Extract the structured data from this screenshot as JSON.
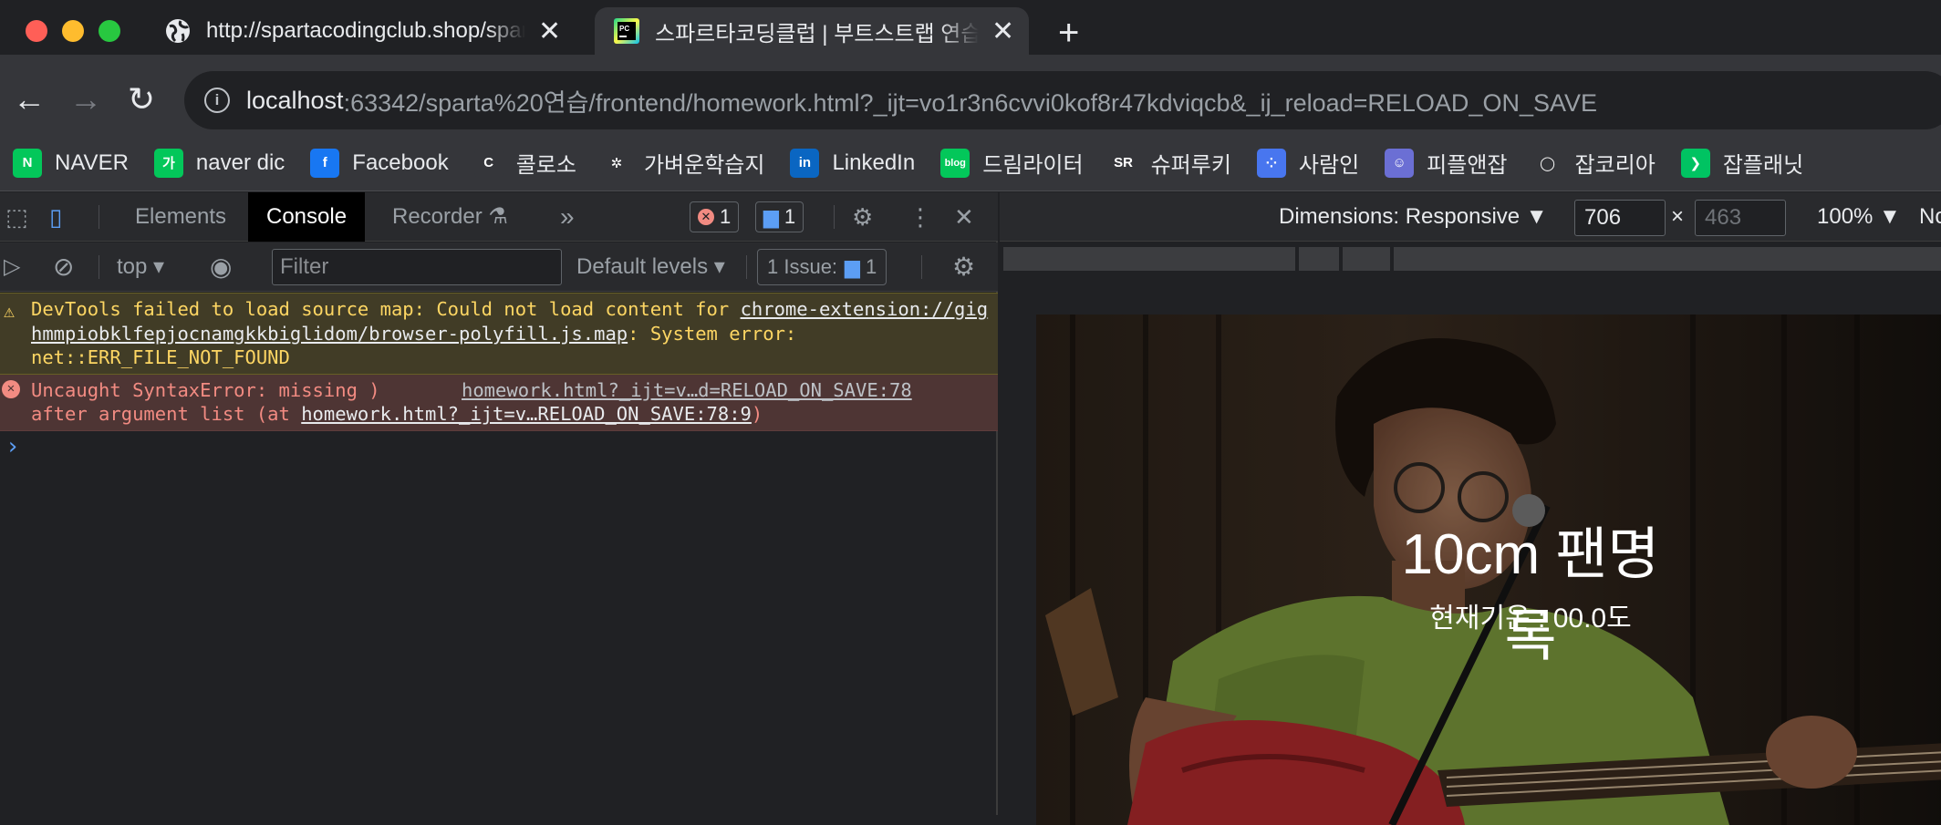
{
  "window": {
    "tabs": [
      {
        "title": "http://spartacodingclub.shop/sparta",
        "icon": "globe-icon",
        "close": "✕"
      },
      {
        "title": "스파르타코딩클럽 | 부트스트랩 연습하기",
        "icon": "pycharm-icon",
        "close": "✕"
      }
    ],
    "new_tab": "+"
  },
  "toolbar": {
    "url_host": "localhost",
    "url_rest": ":63342/sparta%20연습/frontend/homework.html?_ijt=vo1r3n6cvvi0kof8r47kdviqcb&_ij_reload=RELOAD_ON_SAVE",
    "info_icon": "i"
  },
  "bookmarks": [
    {
      "label": "NAVER",
      "icon": "naver-icon",
      "glyph": "N",
      "color": "#03c75a"
    },
    {
      "label": "naver dic",
      "icon": "naver-dictionary-icon",
      "glyph": "가",
      "color": "#03c75a"
    },
    {
      "label": "Facebook",
      "icon": "facebook-icon",
      "glyph": "f",
      "color": "#1877f2"
    },
    {
      "label": "콜로소",
      "icon": "coloso-icon",
      "glyph": "C",
      "color": "#35363a"
    },
    {
      "label": "가벼운학습지",
      "icon": "knot-icon",
      "glyph": "✲",
      "color": "#35363a"
    },
    {
      "label": "LinkedIn",
      "icon": "linkedin-icon",
      "glyph": "in",
      "color": "#0a66c2"
    },
    {
      "label": "드림라이터",
      "icon": "blog-icon",
      "glyph": "blog",
      "color": "#03c75a"
    },
    {
      "label": "슈퍼루키",
      "icon": "superookie-icon",
      "glyph": "SR",
      "color": "#35363a"
    },
    {
      "label": "사람인",
      "icon": "saramin-icon",
      "glyph": "⁘",
      "color": "#4876ef"
    },
    {
      "label": "피플앤잡",
      "icon": "peoplenjob-icon",
      "glyph": "☺",
      "color": "#6b6fd4"
    },
    {
      "label": "잡코리아",
      "icon": "jobkorea-icon",
      "glyph": "◯",
      "color": "#35363a"
    },
    {
      "label": "잡플래닛",
      "icon": "jobplanet-icon",
      "glyph": "❯",
      "color": "#00c362"
    }
  ],
  "devtools": {
    "tabs": [
      "Elements",
      "Console",
      "Recorder"
    ],
    "active_tab": "Console",
    "more": "»",
    "error_count": "1",
    "message_count": "1",
    "context": "top",
    "filter_placeholder": "Filter",
    "levels": "Default levels",
    "issues_label": "1 Issue:",
    "issues_count": "1",
    "messages": [
      {
        "level": "warning",
        "text_before": "DevTools failed to load source map: Could not load content for ",
        "link": "chrome-extension://gighmmpiobklfepjocnamgkkbiglidom/browser-polyfill.js.map",
        "text_after": ": System error: net::ERR_FILE_NOT_FOUND"
      },
      {
        "level": "error",
        "text": "Uncaught SyntaxError: missing )",
        "text2": "after argument list (at ",
        "link": "homework.html?_ijt=v…RELOAD_ON_SAVE:78:9",
        "close_paren": ")",
        "source": "homework.html?_ijt=v…d=RELOAD_ON_SAVE:78"
      }
    ],
    "prompt": "›"
  },
  "device_toolbar": {
    "dimensions": "Dimensions: Responsive ▼",
    "width": "706",
    "height": "463",
    "times": "×",
    "zoom": "100% ▼",
    "throttle": "No"
  },
  "page": {
    "title": "10cm 팬명록",
    "weather": "현재기온 : 00.0도"
  }
}
